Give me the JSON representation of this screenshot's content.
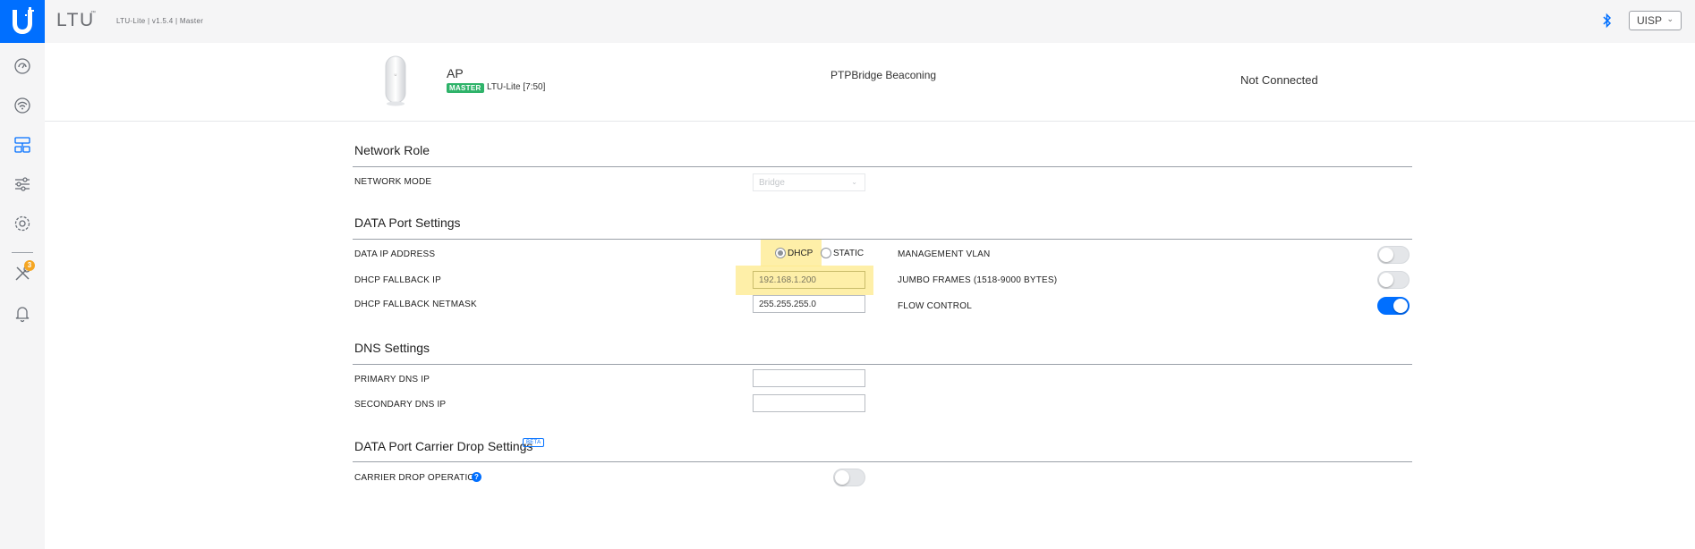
{
  "header": {
    "product_name": "LTU",
    "product_tm": "™",
    "firmware_info": "LTU-Lite | v1.5.4 | Master",
    "uisp_label": "UISP",
    "uisp_chevron": "⌄"
  },
  "icons": {
    "logo": "ubiquiti-logo-icon",
    "bluetooth": "bluetooth-icon",
    "sidebar": [
      "dashboard-icon",
      "wireless-icon",
      "network-icon",
      "settings-sliders-icon",
      "system-gear-icon",
      "tools-icon",
      "notifications-bell-icon"
    ]
  },
  "sidebar": {
    "notification_count": "3"
  },
  "device": {
    "role": "AP",
    "badge": "MASTER",
    "model": "LTU-Lite [7:50]",
    "link_mode": "PTPBridge Beaconing",
    "connection_status": "Not Connected"
  },
  "network_role": {
    "title": "Network Role",
    "network_mode_label": "NETWORK MODE",
    "network_mode_value": "Bridge"
  },
  "data_port": {
    "title": "DATA Port Settings",
    "ip_address_label": "DATA IP ADDRESS",
    "dhcp_label": "DHCP",
    "static_label": "STATIC",
    "selected_mode": "DHCP",
    "fallback_ip_label": "DHCP FALLBACK IP",
    "fallback_ip_value": "192.168.1.200",
    "fallback_netmask_label": "DHCP FALLBACK NETMASK",
    "fallback_netmask_value": "255.255.255.0",
    "management_vlan_label": "MANAGEMENT VLAN",
    "management_vlan_on": false,
    "jumbo_frames_label": "JUMBO FRAMES (1518-9000 BYTES)",
    "jumbo_frames_on": false,
    "flow_control_label": "FLOW CONTROL",
    "flow_control_on": true
  },
  "dns": {
    "title": "DNS Settings",
    "primary_label": "PRIMARY DNS IP",
    "primary_value": "",
    "secondary_label": "SECONDARY DNS IP",
    "secondary_value": ""
  },
  "carrier_drop": {
    "title": "DATA Port Carrier Drop Settings",
    "beta_badge": "BETA",
    "operation_label": "CARRIER DROP OPERATION",
    "help_glyph": "?",
    "operation_on": false
  },
  "colors": {
    "accent": "#006fff",
    "master_badge": "#2fb36a",
    "highlight": "#fde98b",
    "notification_badge": "#f5a623"
  }
}
